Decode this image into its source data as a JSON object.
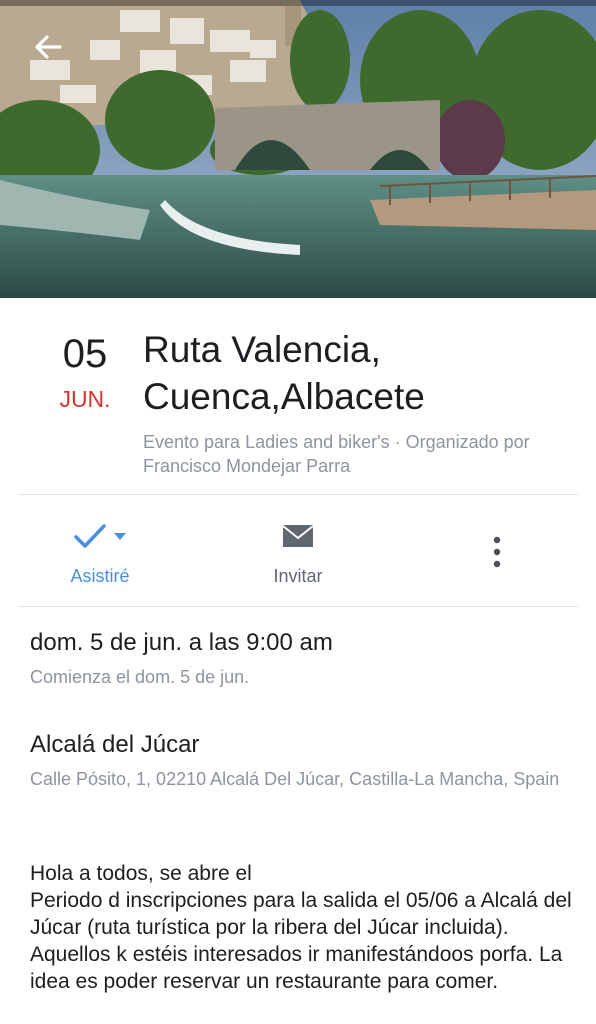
{
  "event": {
    "day": "05",
    "month": "JUN.",
    "title": "Ruta Valencia, Cuenca,Albacete",
    "subtitle": "Evento para Ladies and biker's · Organizado por Francisco Mondejar Parra"
  },
  "actions": {
    "going_label": "Asistiré",
    "invite_label": "Invitar"
  },
  "when": {
    "primary": "dom. 5 de jun. a las 9:00 am",
    "secondary": "Comienza el dom. 5 de jun."
  },
  "where": {
    "primary": "Alcalá del Júcar",
    "secondary": "Calle Pósito, 1, 02210 Alcalá Del Júcar, Castilla-La Mancha, Spain"
  },
  "description": "Hola a todos, se abre el\nPeriodo d inscripciones para la salida el 05/06 a Alcalá del Júcar (ruta turística por la ribera del Júcar incluida). Aquellos k estéis interesados ir manifestándoos porfa. La idea es poder reservar un restaurante para comer.",
  "colors": {
    "accent_blue": "#4a90e2",
    "month_red": "#d9342b",
    "secondary_text": "#8d949e"
  },
  "icons": [
    "back-arrow-icon",
    "checkmark-icon",
    "dropdown-caret-icon",
    "envelope-icon",
    "more-vertical-icon"
  ]
}
